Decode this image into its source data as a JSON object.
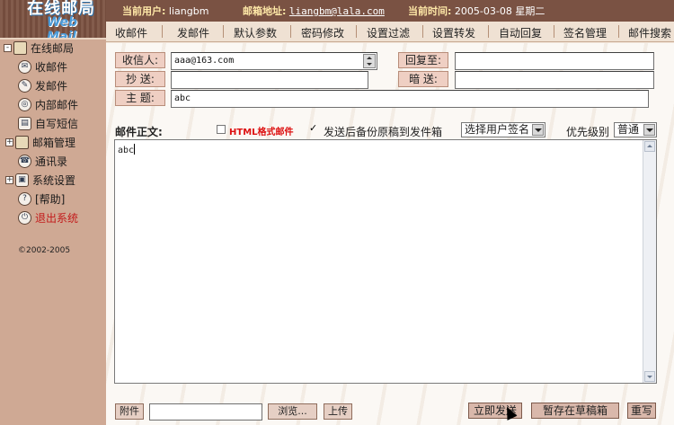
{
  "logo": {
    "title": "在线邮局",
    "subtitle": "Web Mail"
  },
  "header": {
    "user_label": "当前用户:",
    "user_value": "liangbm",
    "email_label": "邮箱地址:",
    "email_value": "liangbm@lala.com",
    "time_label": "当前时间:",
    "time_value": "2005-03-08 星期二"
  },
  "menu": [
    {
      "label": "收邮件"
    },
    {
      "label": "发邮件"
    },
    {
      "label": "默认参数"
    },
    {
      "label": "密码修改"
    },
    {
      "label": "设置过滤"
    },
    {
      "label": "设置转发"
    },
    {
      "label": "自动回复"
    },
    {
      "label": "签名管理"
    },
    {
      "label": "邮件搜索"
    }
  ],
  "sidebar": {
    "root": "在线邮局",
    "items": [
      {
        "label": "收邮件",
        "icon": "inbox-icon"
      },
      {
        "label": "发邮件",
        "icon": "send-icon"
      },
      {
        "label": "内部邮件",
        "icon": "internal-mail-icon"
      },
      {
        "label": "自写短信",
        "icon": "sms-icon"
      },
      {
        "label": "邮箱管理",
        "icon": "folder-icon",
        "expandable": true
      },
      {
        "label": "通讯录",
        "icon": "address-book-icon"
      },
      {
        "label": "系统设置",
        "icon": "settings-icon",
        "expandable": true
      },
      {
        "label": "[帮助]",
        "icon": "help-icon"
      },
      {
        "label": "退出系统",
        "icon": "logout-icon",
        "color": "#c31b1b"
      }
    ],
    "copyright": "©2002-2005"
  },
  "compose": {
    "to_label": "收信人:",
    "to_value": "aaa@163.com",
    "reply_label": "回复至:",
    "reply_value": "",
    "cc_label": "抄  送:",
    "cc_value": "",
    "bcc_label": "暗  送:",
    "bcc_value": "",
    "subject_label": "主  题:",
    "subject_value": "abc",
    "body_label": "邮件正文:",
    "html_label": "HTML格式邮件",
    "html_checked": false,
    "backup_label": "发送后备份原稿到发件箱",
    "backup_checked": true,
    "signature_select": "选择用户签名",
    "priority_label": "优先级别",
    "priority_value": "普通",
    "body_value": "abc"
  },
  "footer": {
    "attach_label": "附件",
    "attach_value": "",
    "browse_label": "浏览...",
    "upload_label": "上传",
    "send_label": "立即发送",
    "draft_label": "暂存在草稿箱",
    "reset_label": "重写"
  },
  "colors": {
    "header_bg": "#7a5243",
    "sidebar_bg": "#cfa994",
    "label_bg": "#efcfc3",
    "accent_red": "#d11111"
  }
}
